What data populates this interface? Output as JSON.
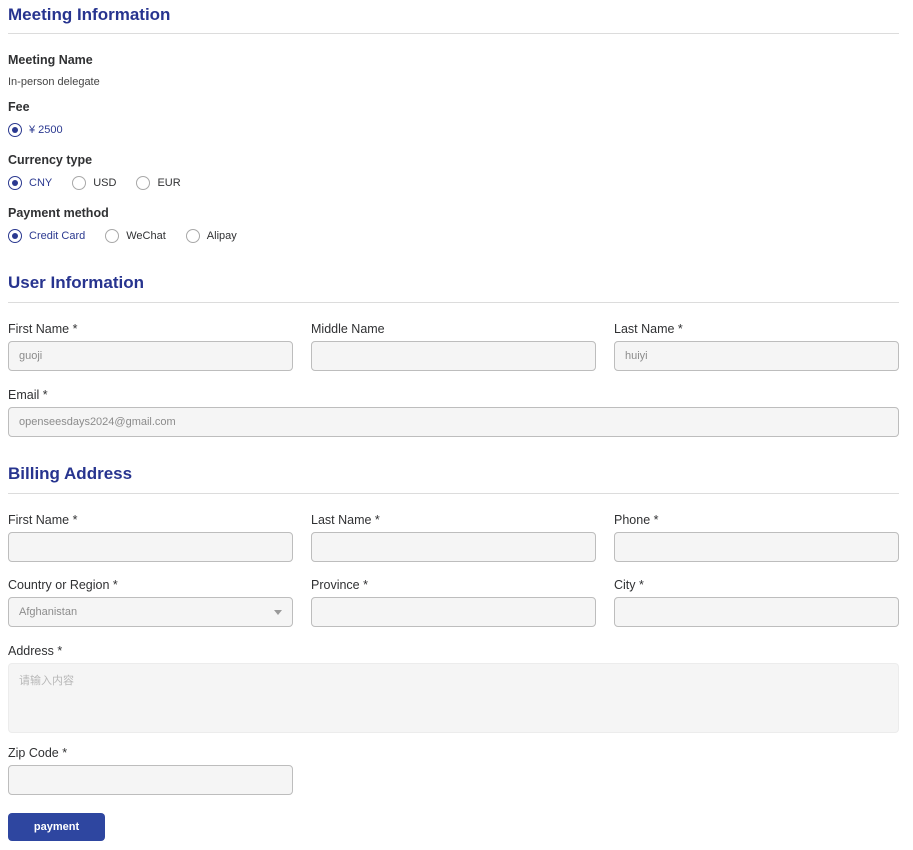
{
  "meeting": {
    "title": "Meeting Information",
    "meeting_name": {
      "label": "Meeting Name",
      "value": "In-person delegate"
    },
    "fee": {
      "label": "Fee",
      "options": [
        {
          "label": "¥ 2500",
          "selected": true
        }
      ],
      "selected": "¥ 2500"
    },
    "currency": {
      "label": "Currency type",
      "options": [
        {
          "label": "CNY",
          "selected": true
        },
        {
          "label": "USD",
          "selected": false
        },
        {
          "label": "EUR",
          "selected": false
        }
      ],
      "selected": "CNY"
    },
    "payment_method": {
      "label": "Payment method",
      "options": [
        {
          "label": "Credit Card",
          "selected": true
        },
        {
          "label": "WeChat",
          "selected": false
        },
        {
          "label": "Alipay",
          "selected": false
        }
      ],
      "selected": "Credit Card"
    }
  },
  "user": {
    "title": "User Information",
    "first_name": {
      "label": "First Name *",
      "value": "guoji"
    },
    "middle_name": {
      "label": "Middle Name",
      "value": ""
    },
    "last_name": {
      "label": "Last Name *",
      "value": "huiyi"
    },
    "email": {
      "label": "Email *",
      "value": "openseesdays2024@gmail.com"
    }
  },
  "billing": {
    "title": "Billing Address",
    "first_name": {
      "label": "First Name *",
      "value": ""
    },
    "last_name": {
      "label": "Last Name *",
      "value": ""
    },
    "phone": {
      "label": "Phone *",
      "value": ""
    },
    "country": {
      "label": "Country or Region *",
      "value": "Afghanistan"
    },
    "province": {
      "label": "Province *",
      "value": ""
    },
    "city": {
      "label": "City *",
      "value": ""
    },
    "address": {
      "label": "Address *",
      "value": "",
      "placeholder": "请输入内容"
    },
    "zip": {
      "label": "Zip Code *",
      "value": ""
    }
  },
  "actions": {
    "payment": "payment"
  },
  "colors": {
    "heading": "#27348f",
    "accent": "#2b3990",
    "button": "#2e46a0",
    "input_bg": "#f5f5f5",
    "input_border": "#bdbdbd",
    "divider": "#dcdcdc"
  }
}
